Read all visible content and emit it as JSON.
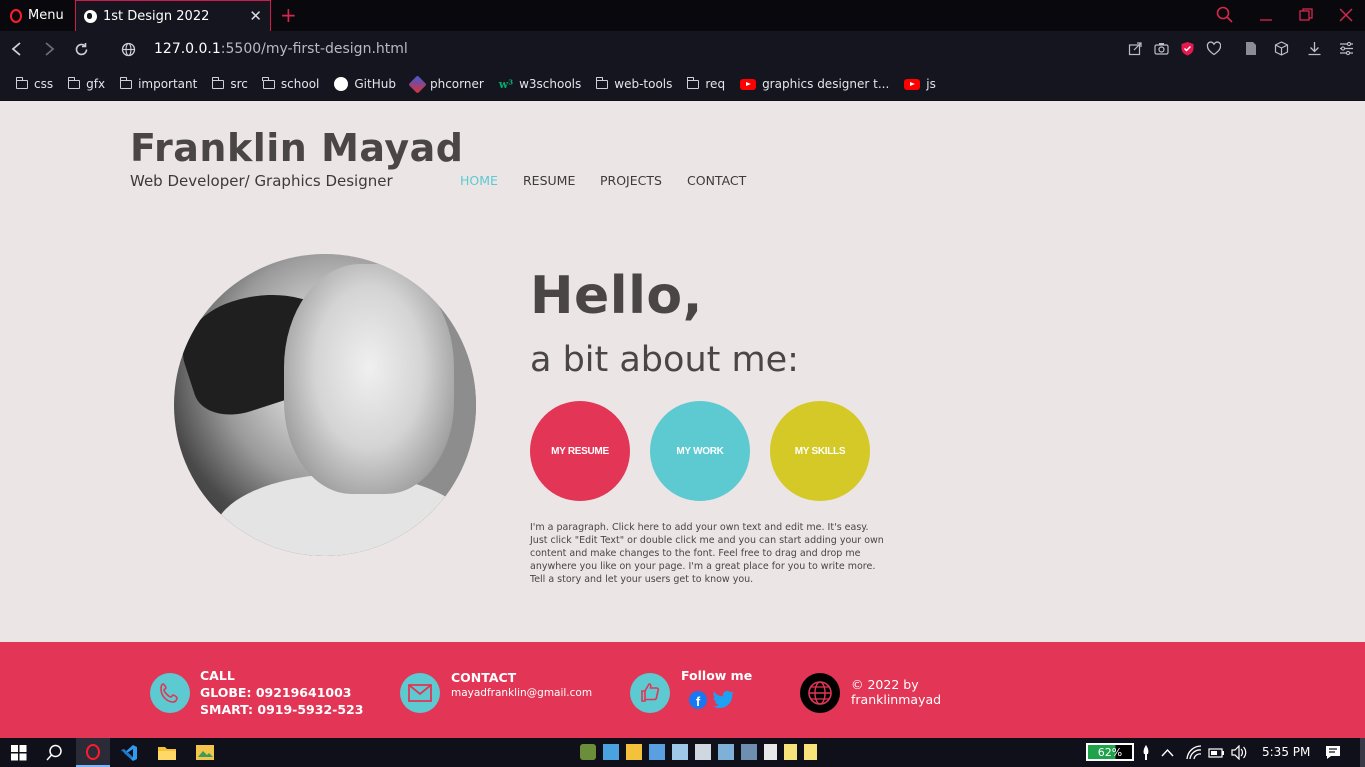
{
  "browser": {
    "menu_label": "Menu",
    "tab_title": "1st Design 2022",
    "tab_close": "✕",
    "new_tab": "+",
    "url_host": "127.0.0.1",
    "url_rest": ":5500/my-first-design.html",
    "bookmarks": [
      {
        "label": "css",
        "icon": "folder-icon"
      },
      {
        "label": "gfx",
        "icon": "folder-icon"
      },
      {
        "label": "important",
        "icon": "folder-icon"
      },
      {
        "label": "src",
        "icon": "folder-icon"
      },
      {
        "label": "school",
        "icon": "folder-icon"
      },
      {
        "label": "GitHub",
        "icon": "github-icon"
      },
      {
        "label": "phcorner",
        "icon": "phcorner-icon"
      },
      {
        "label": "w3schools",
        "icon": "w3schools-icon"
      },
      {
        "label": "web-tools",
        "icon": "folder-icon"
      },
      {
        "label": "req",
        "icon": "folder-icon"
      },
      {
        "label": "graphics designer t...",
        "icon": "youtube-icon"
      },
      {
        "label": "js",
        "icon": "youtube-icon"
      }
    ],
    "accent": "#d6284f"
  },
  "header": {
    "title": "Franklin Mayad",
    "subtitle": "Web Developer/ Graphics Designer",
    "nav": [
      "HOME",
      "RESUME",
      "PROJECTS",
      "CONTACT"
    ],
    "nav_active_color": "#5ccad0"
  },
  "hero": {
    "hello": "Hello,",
    "about": "a bit about me:",
    "buttons": [
      {
        "label": "MY RESUME",
        "color": "#e33555"
      },
      {
        "label": "MY WORK",
        "color": "#5ccad0"
      },
      {
        "label": "MY SKILLS",
        "color": "#d4c926"
      }
    ],
    "paragraph": "I'm a paragraph. Click here to add your own text and edit me. It's easy. Just click \"Edit Text\" or double click me and you can start adding your own content and make changes to the font. Feel free to drag and drop me anywhere you like on your page. I'm a great place for you to write more. Tell a story and let your users get to know you."
  },
  "footer": {
    "call_title": "CALL",
    "call_globe": "GLOBE: 09219641003",
    "call_smart": "SMART: 0919-5932-523",
    "contact_title": "CONTACT",
    "contact_email": "mayadfranklin@gmail.com",
    "follow_title": "Follow me",
    "copyright_line1": "© 2022 by",
    "copyright_line2": "franklinmayad",
    "bg_color": "#e33555"
  },
  "taskbar": {
    "battery": "62%",
    "time": "5:35 PM"
  }
}
